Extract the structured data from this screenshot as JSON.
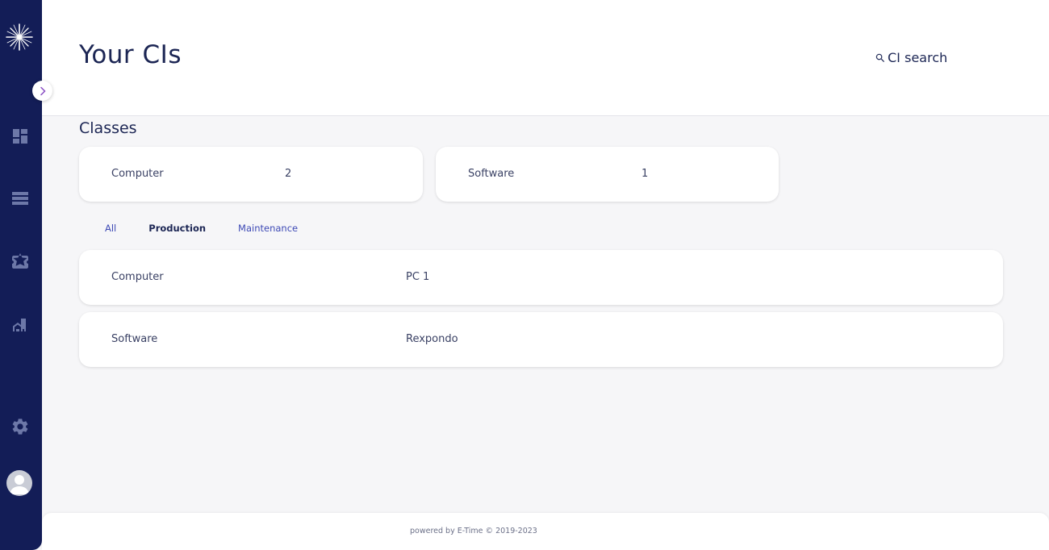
{
  "colors": {
    "sidebar_bg": "#131d57",
    "accent": "#3d49b5",
    "text_dark": "#1c2654",
    "page_bg": "#f6f6f8"
  },
  "sidebar": {
    "logo_icon": "star-burst-logo",
    "items": [
      {
        "icon": "dashboard-icon"
      },
      {
        "icon": "list-icon"
      },
      {
        "icon": "ticket-icon"
      },
      {
        "icon": "building-icon"
      },
      {
        "icon": "gear-icon"
      }
    ],
    "avatar_icon": "user-avatar"
  },
  "header": {
    "title": "Your CIs",
    "search_label": "CI search",
    "search_icon": "search-icon"
  },
  "classes": {
    "title": "Classes",
    "items": [
      {
        "name": "Computer",
        "count": "2"
      },
      {
        "name": "Software",
        "count": "1"
      }
    ]
  },
  "tabs": [
    {
      "label": "All",
      "active": false
    },
    {
      "label": "Production",
      "active": true
    },
    {
      "label": "Maintenance",
      "active": false
    }
  ],
  "cis": [
    {
      "class": "Computer",
      "name": "PC 1"
    },
    {
      "class": "Software",
      "name": "Rexpondo"
    }
  ],
  "footer": {
    "text": "powered by E-Time © 2019-2023"
  }
}
